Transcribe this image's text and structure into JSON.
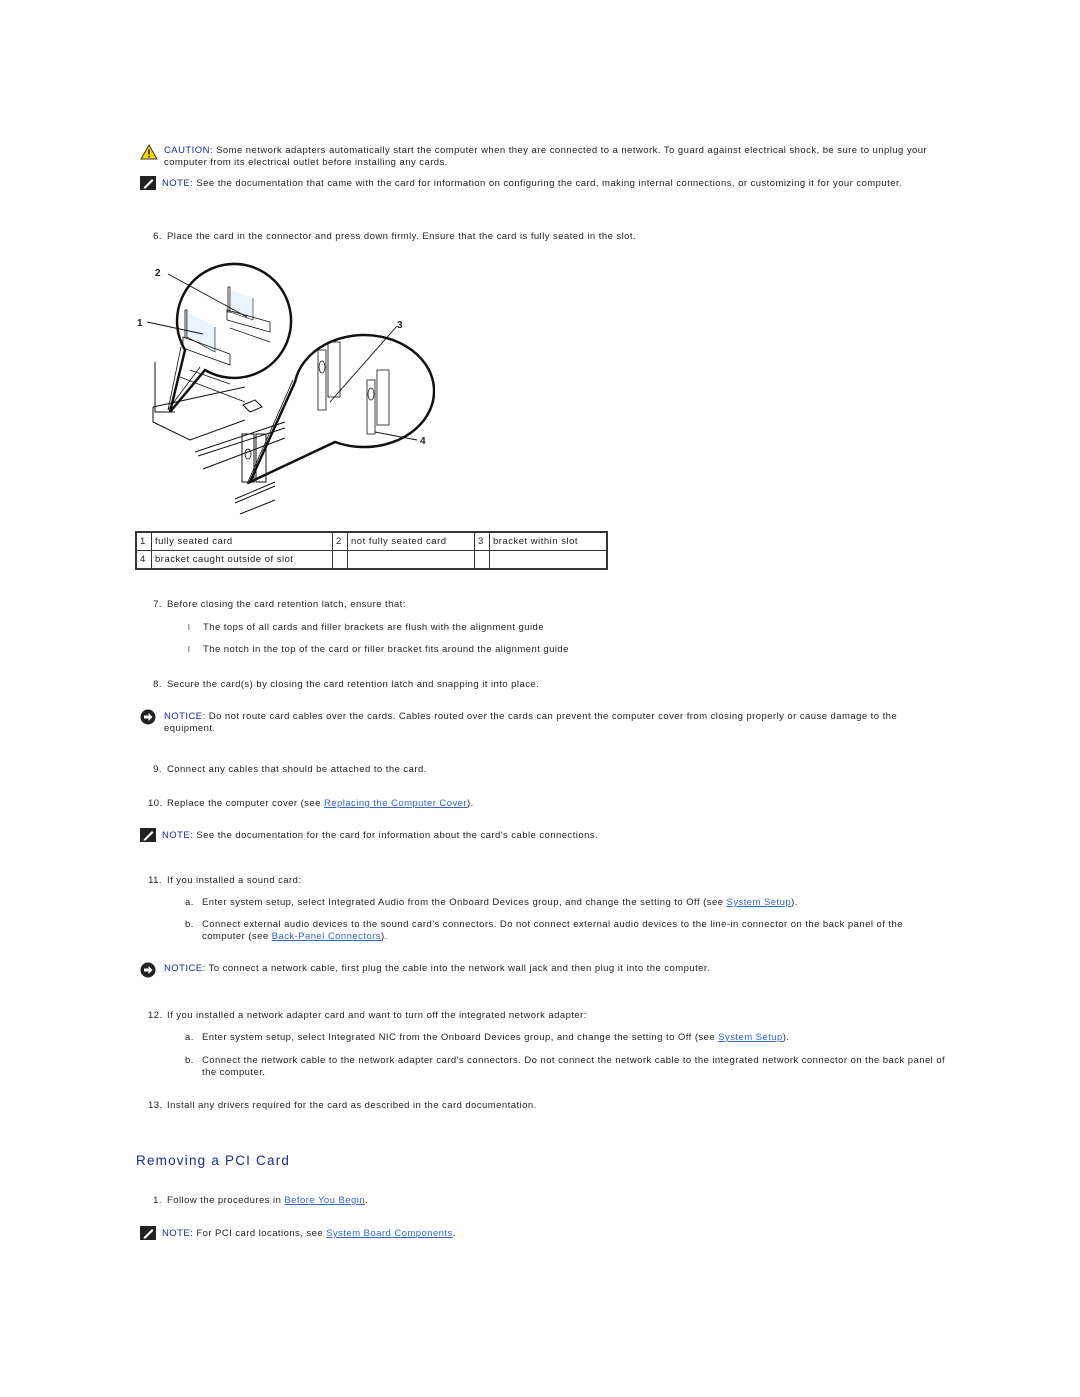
{
  "caution": {
    "label": "CAUTION:",
    "text": " Some network adapters automatically start the computer when they are connected to a network. To guard against electrical shock, be sure to unplug your computer from its electrical outlet before installing any cards."
  },
  "note1": {
    "label": "NOTE:",
    "text": " See the documentation that came with the card for information on configuring the card, making internal connections, or customizing it for your computer."
  },
  "step6": {
    "num": "6.",
    "text": "Place the card in the connector and press down firmly. Ensure that the card is fully seated in the slot."
  },
  "figure": {
    "callouts": [
      "1",
      "2",
      "3",
      "4"
    ]
  },
  "legend": {
    "rows": [
      [
        {
          "num": "1",
          "label": "fully seated card"
        },
        {
          "num": "2",
          "label": "not fully seated card"
        },
        {
          "num": "3",
          "label": "bracket within slot"
        }
      ],
      [
        {
          "num": "4",
          "label": "bracket caught outside of slot"
        },
        {
          "num": "",
          "label": ""
        },
        {
          "num": "",
          "label": ""
        }
      ]
    ]
  },
  "step7": {
    "num": "7.",
    "text": "Before closing the card retention latch, ensure that:",
    "bullets": [
      "The tops of all cards and filler brackets are flush with the alignment guide",
      "The notch in the top of the card or filler bracket fits around the alignment guide"
    ],
    "bullet_mark": "l"
  },
  "step8": {
    "num": "8.",
    "text": "Secure the card(s) by closing the card retention latch and snapping it into place."
  },
  "notice1": {
    "label": "NOTICE:",
    "text": " Do not route card cables over the cards. Cables routed over the cards can prevent the computer cover from closing properly or cause damage to the equipment."
  },
  "step9": {
    "num": "9.",
    "text": "Connect any cables that should be attached to the card."
  },
  "step10": {
    "num": "10.",
    "text_before": "Replace the computer cover (see ",
    "link": "Replacing the Computer Cover",
    "text_after": ")."
  },
  "note2": {
    "label": "NOTE:",
    "text": " See the documentation for the card for information about the card's cable connections."
  },
  "step11": {
    "num": "11.",
    "text": "If you installed a sound card:",
    "a": {
      "num": "a.",
      "text_before": "Enter system setup, select Integrated Audio from the Onboard Devices group, and change the setting to Off (see ",
      "link": "System Setup",
      "text_after": ")."
    },
    "b": {
      "num": "b.",
      "text_before": "Connect external audio devices to the sound card's connectors. Do not connect external audio devices to the line-in connector on the back panel of the computer (see ",
      "link": "Back-Panel Connectors",
      "text_after": ")."
    }
  },
  "notice2": {
    "label": "NOTICE:",
    "text": " To connect a network cable, first plug the cable into the network wall jack and then plug it into the computer."
  },
  "step12": {
    "num": "12.",
    "text": "If you installed a network adapter card and want to turn off the integrated network adapter:",
    "a": {
      "num": "a.",
      "text_before": "Enter system setup, select Integrated NIC from the Onboard Devices group, and change the setting to Off (see ",
      "link": "System Setup",
      "text_after": ")."
    },
    "b": {
      "num": "b.",
      "text": "Connect the network cable to the network adapter card's connectors. Do not connect the network cable to the integrated network connector on the back panel of the computer."
    }
  },
  "step13": {
    "num": "13.",
    "text": "Install any drivers required for the card as described in the card documentation."
  },
  "removing": {
    "heading": "Removing a PCI Card",
    "step1": {
      "num": "1.",
      "text_before": "Follow the procedures in ",
      "link": "Before You Begin",
      "text_after": "."
    },
    "note": {
      "label": "NOTE:",
      "text_before": " For PCI card locations, see ",
      "link": "System Board Components",
      "text_after": "."
    }
  },
  "colors": {
    "label_blue": "#1a2a9c",
    "link_blue": "#3366cc",
    "caution_yellow": "#f5d800"
  }
}
